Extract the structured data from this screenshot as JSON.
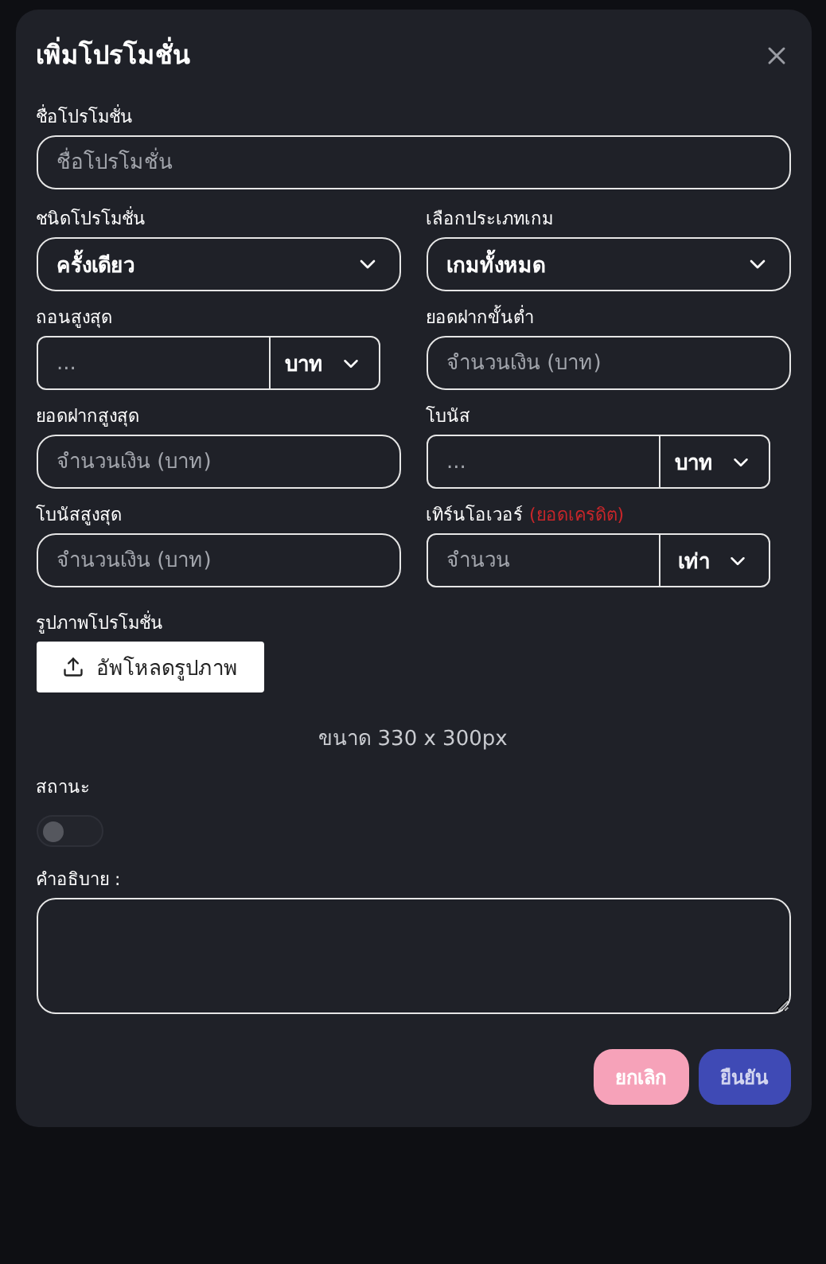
{
  "dialog": {
    "title": "เพิ่มโปรโมชั่น"
  },
  "name_field": {
    "label": "ชื่อโปรโมชั่น",
    "placeholder": "ชื่อโปรโมชั่น"
  },
  "fields": [
    {
      "kind": "select",
      "label": "ชนิดโปรโมชั่น",
      "value": "ครั้งเดียว"
    },
    {
      "kind": "select",
      "label": "เลือกประเภทเกม",
      "value": "เกมทั้งหมด"
    },
    {
      "kind": "unit",
      "label": "ถอนสูงสุด",
      "placeholder": "...",
      "unit": "บาท"
    },
    {
      "kind": "text",
      "label": "ยอดฝากขั้นต่ำ",
      "placeholder": "จำนวนเงิน (บาท)"
    },
    {
      "kind": "text",
      "label": "ยอดฝากสูงสุด",
      "placeholder": "จำนวนเงิน (บาท)"
    },
    {
      "kind": "unit",
      "label": "โบนัส",
      "placeholder": "...",
      "unit": "บาท"
    },
    {
      "kind": "text",
      "label": "โบนัสสูงสุด",
      "placeholder": "จำนวนเงิน (บาท)"
    },
    {
      "kind": "unit",
      "label": "เทิร์นโอเวอร์",
      "note": "(ยอดเครดิต)",
      "placeholder": "จำนวน",
      "unit": "เท่า"
    }
  ],
  "image": {
    "label": "รูปภาพโปรโมชั่น",
    "button": "อัพโหลดรูปภาพ",
    "size_hint": "ขนาด 330 x 300px"
  },
  "status": {
    "label": "สถานะ",
    "on": false
  },
  "description": {
    "label": "คำอธิบาย :"
  },
  "buttons": [
    {
      "kind": "cancel",
      "label": "ยกเลิก"
    },
    {
      "kind": "confirm",
      "label": "ยืนยัน"
    }
  ]
}
